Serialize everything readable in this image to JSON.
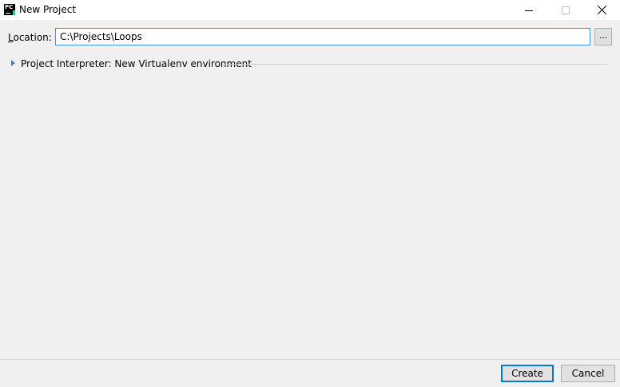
{
  "window": {
    "title": "New Project",
    "app_icon": "pycharm-icon"
  },
  "location": {
    "label_underlined": "L",
    "label_rest": "ocation:",
    "value": "C:\\Projects\\Loops",
    "browse_label": "..."
  },
  "interpreter": {
    "label": "Project Interpreter: New Virtualenv environment",
    "expanded": false
  },
  "footer": {
    "create_label": "Create",
    "cancel_label": "Cancel"
  },
  "colors": {
    "focus_border": "#3d8fe0",
    "default_button_border": "#0078d7",
    "expander_arrow": "#4a7db5"
  }
}
